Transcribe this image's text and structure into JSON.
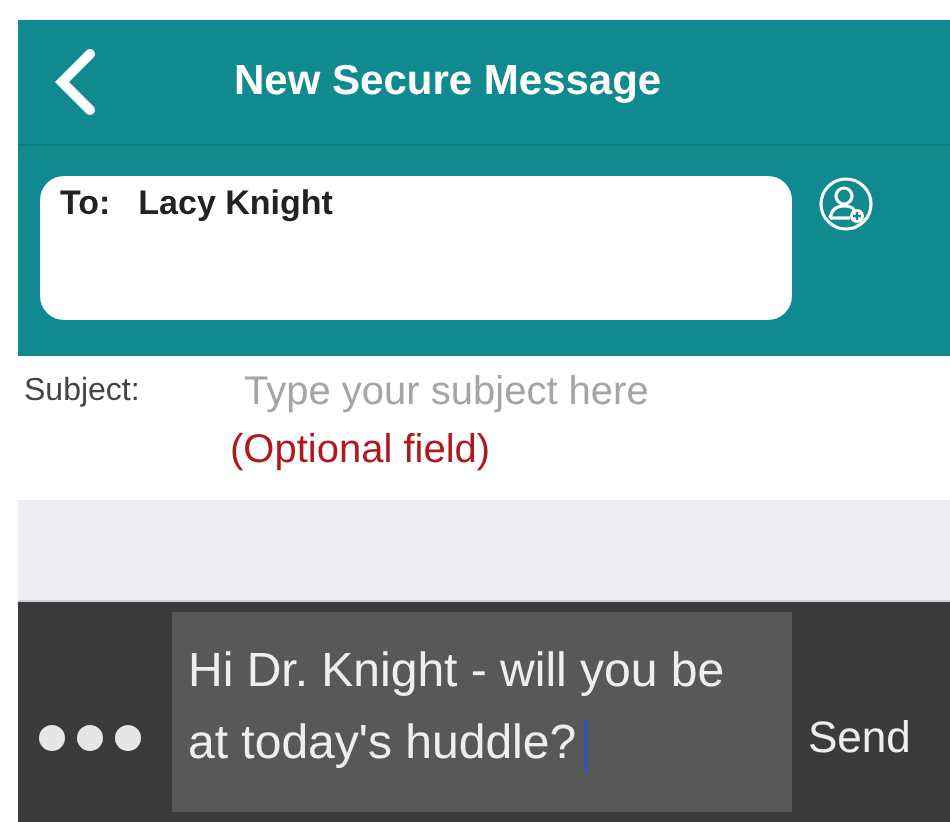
{
  "header": {
    "title": "New Secure Message"
  },
  "recipient": {
    "label": "To:",
    "value": "Lacy Knight"
  },
  "subject": {
    "label": "Subject:",
    "placeholder": "Type your subject here",
    "note": "(Optional field)"
  },
  "composer": {
    "value": "Hi Dr. Knight - will you be at today's huddle?",
    "send": "Send"
  }
}
